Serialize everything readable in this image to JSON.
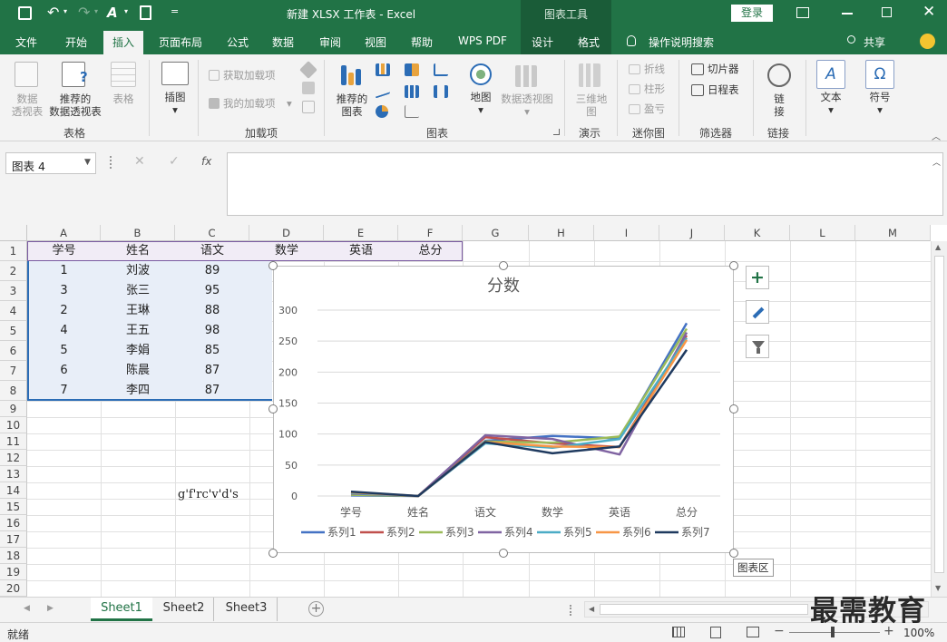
{
  "titlebar": {
    "title": "新建 XLSX 工作表  -  Excel",
    "context_tab": "图表工具",
    "login": "登录",
    "qat_more": "="
  },
  "tabs": [
    {
      "label": "文件"
    },
    {
      "label": "开始"
    },
    {
      "label": "插入"
    },
    {
      "label": "页面布局"
    },
    {
      "label": "公式"
    },
    {
      "label": "数据"
    },
    {
      "label": "审阅"
    },
    {
      "label": "视图"
    },
    {
      "label": "帮助"
    },
    {
      "label": "WPS PDF"
    },
    {
      "label": "设计"
    },
    {
      "label": "格式"
    }
  ],
  "tell_me": "操作说明搜索",
  "share": "共享",
  "ribbon": {
    "pivot_table": "数据\n透视表",
    "recommended_pivot": "推荐的\n数据透视表",
    "table": "表格",
    "group_tables": "表格",
    "illustrations": "插图",
    "get_addins": "获取加载项",
    "my_addins": "我的加载项",
    "group_addins": "加载项",
    "recommended_charts": "推荐的\n图表",
    "maps": "地图",
    "pivot_chart": "数据透视图",
    "group_charts": "图表",
    "map3d": "三维地\n图",
    "group_tours": "演示",
    "spark_line": "折线",
    "spark_column": "柱形",
    "spark_winloss": "盈亏",
    "group_sparklines": "迷你图",
    "slicer": "切片器",
    "timeline": "日程表",
    "group_filters": "筛选器",
    "link": "链\n接",
    "group_links": "链接",
    "text": "文本",
    "symbol": "符号"
  },
  "formula_bar": {
    "name_box": "图表 4",
    "fx": "fx",
    "content": ""
  },
  "columns": [
    "A",
    "B",
    "C",
    "D",
    "E",
    "F",
    "G",
    "H",
    "I",
    "J",
    "K",
    "L",
    "M"
  ],
  "rows": [
    "1",
    "2",
    "3",
    "4",
    "5",
    "6",
    "7",
    "8",
    "9",
    "10",
    "11",
    "12",
    "13",
    "14",
    "15",
    "16",
    "17",
    "18",
    "19",
    "20"
  ],
  "table": {
    "headers": [
      "学号",
      "姓名",
      "语文",
      "数学",
      "英语",
      "总分"
    ],
    "rows": [
      [
        "1",
        "刘波",
        "89"
      ],
      [
        "3",
        "张三",
        "95"
      ],
      [
        "2",
        "王琳",
        "88"
      ],
      [
        "4",
        "王五",
        "98"
      ],
      [
        "5",
        "李娟",
        "85"
      ],
      [
        "6",
        "陈晨",
        "87"
      ],
      [
        "7",
        "李四",
        "87"
      ]
    ]
  },
  "stray_text": "g'f'rc'v'd's",
  "chart_tooltip": "图表区",
  "chart_data": {
    "type": "line",
    "title": "分数",
    "categories": [
      "学号",
      "姓名",
      "语文",
      "数学",
      "英语",
      "总分"
    ],
    "ylim": [
      0,
      300
    ],
    "yticks": [
      0,
      50,
      100,
      150,
      200,
      250,
      300
    ],
    "grid": true,
    "legend": "bottom",
    "series": [
      {
        "name": "系列1",
        "color": "#4472c4",
        "values": [
          1,
          0,
          89,
          97,
          93,
          279
        ]
      },
      {
        "name": "系列2",
        "color": "#c0504d",
        "values": [
          3,
          0,
          95,
          85,
          79,
          259
        ]
      },
      {
        "name": "系列3",
        "color": "#9bbb59",
        "values": [
          2,
          0,
          88,
          86,
          96,
          270
        ]
      },
      {
        "name": "系列4",
        "color": "#8064a2",
        "values": [
          4,
          0,
          98,
          92,
          67,
          264
        ]
      },
      {
        "name": "系列5",
        "color": "#4bacc6",
        "values": [
          5,
          0,
          85,
          78,
          92,
          255
        ]
      },
      {
        "name": "系列6",
        "color": "#f79646",
        "values": [
          6,
          0,
          87,
          80,
          79,
          252
        ]
      },
      {
        "name": "系列7",
        "color": "#1f3a5f",
        "values": [
          7,
          0,
          87,
          69,
          80,
          236
        ]
      }
    ]
  },
  "sheets": [
    {
      "label": "Sheet1"
    },
    {
      "label": "Sheet2"
    },
    {
      "label": "Sheet3"
    }
  ],
  "status": {
    "ready": "就绪",
    "zoom": "100%"
  },
  "watermark": "最需教育",
  "colors": {
    "excel_green": "#217346",
    "selection_fill": "#e8eef8",
    "selection_border": "#7a5aa0"
  }
}
